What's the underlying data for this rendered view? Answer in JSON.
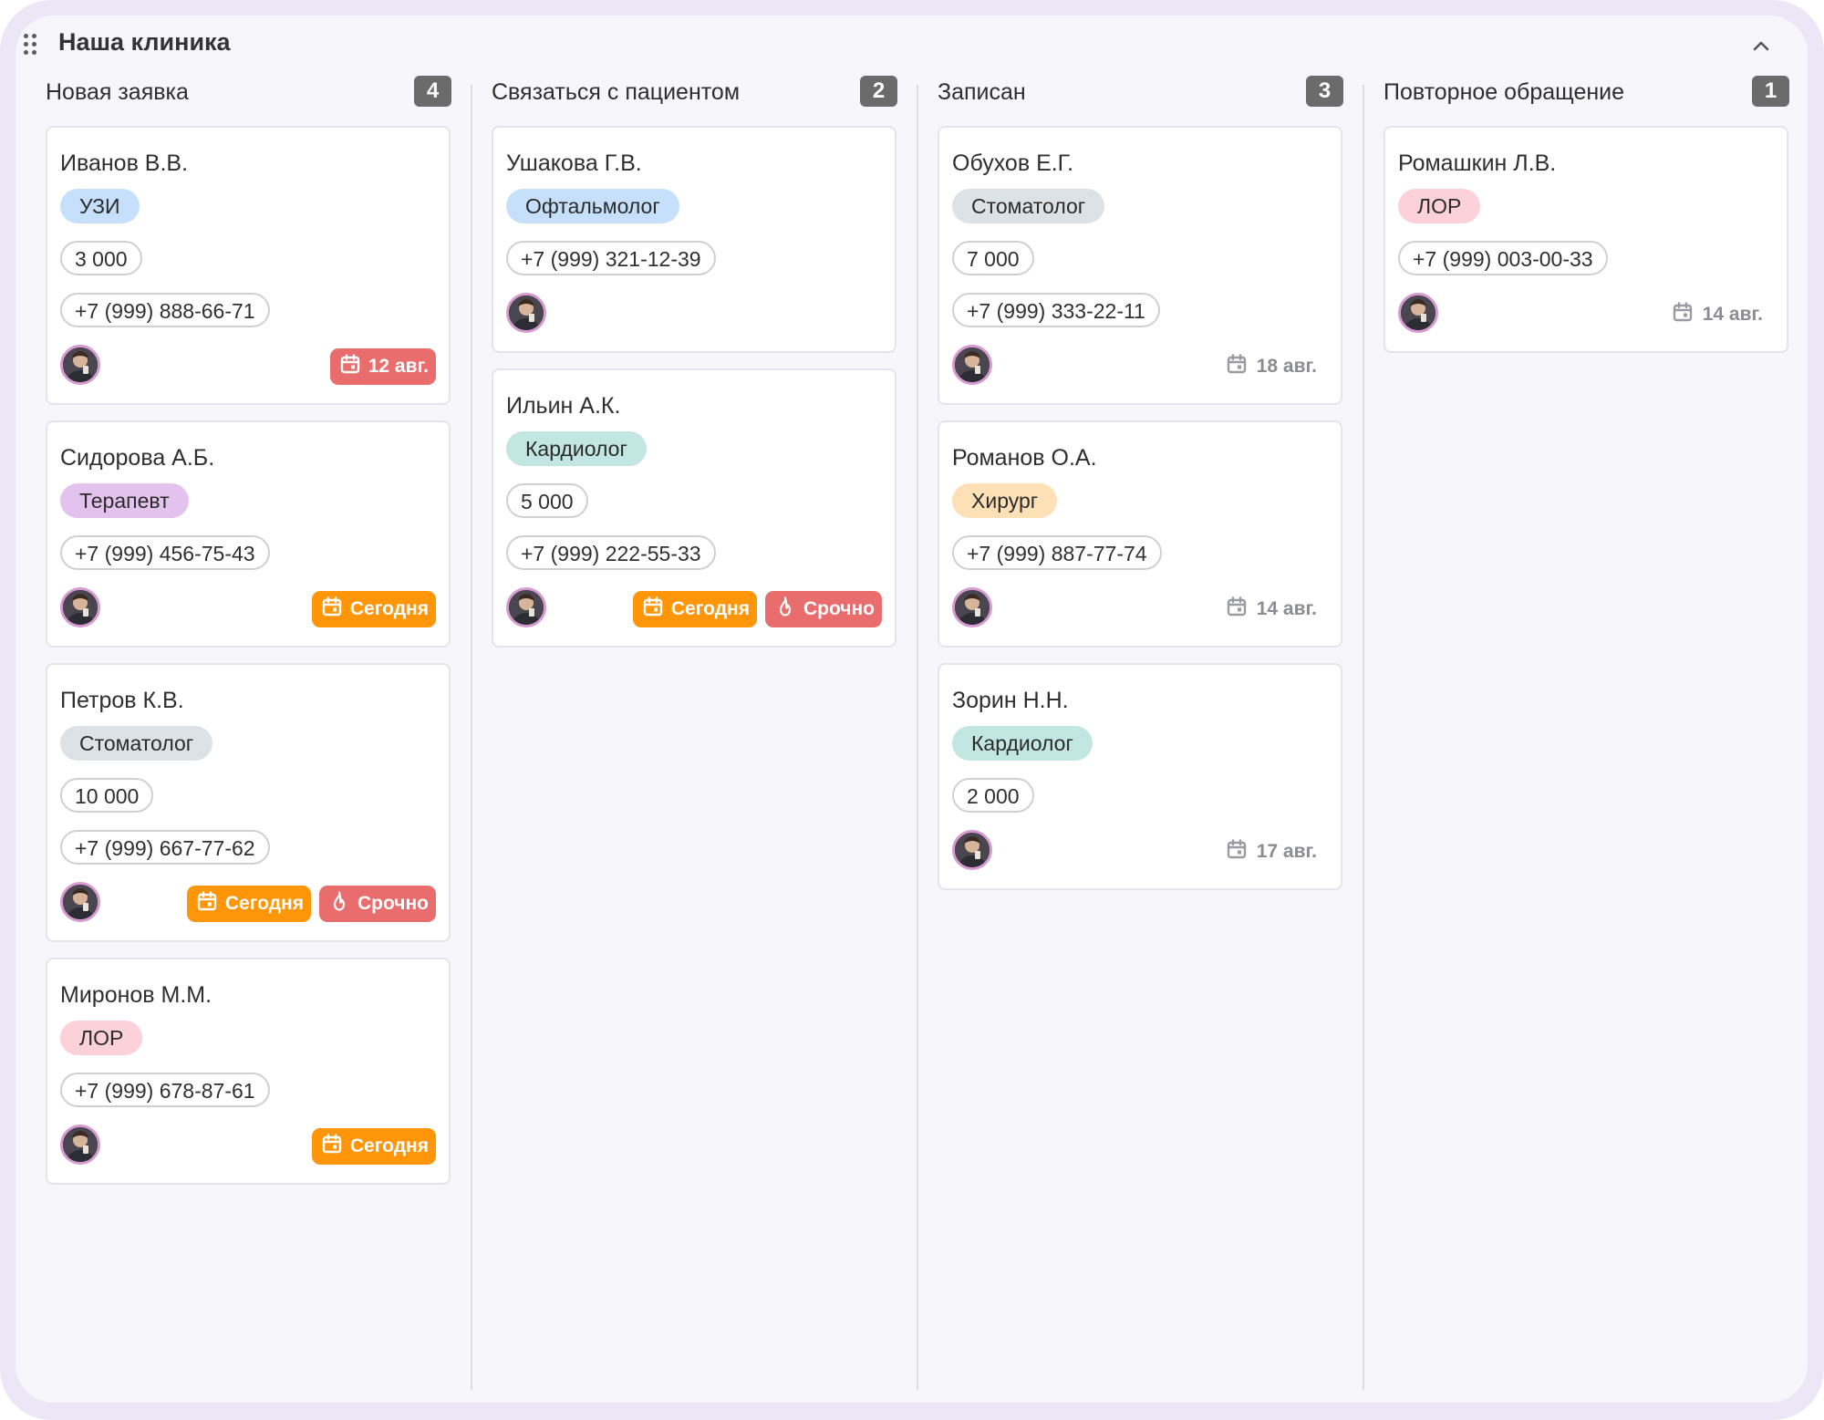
{
  "board": {
    "title": "Наша клиника"
  },
  "colors": {
    "tag_blue": "#c6e0fb",
    "tag_purple": "#e3c2ee",
    "tag_gray": "#dde2e6",
    "tag_pink": "#fcd1d9",
    "tag_teal": "#c2e6e1",
    "tag_peach": "#fde0b6",
    "badge_red": "#ea6d6d",
    "badge_orange": "#ff960a"
  },
  "columns": [
    {
      "title": "Новая заявка",
      "count": "4",
      "cards": [
        {
          "name": "Иванов В.В.",
          "tag": "УЗИ",
          "tag_color": "blue",
          "pills": [
            "3 000",
            "+7 (999) 888-66-71"
          ],
          "badges": [
            {
              "text": "12 авг.",
              "kind": "red",
              "icon": "calendar-icon"
            }
          ]
        },
        {
          "name": "Сидорова А.Б.",
          "tag": "Терапевт",
          "tag_color": "purple",
          "pills": [
            "+7 (999) 456-75-43"
          ],
          "badges": [
            {
              "text": "Сегодня",
              "kind": "orange",
              "icon": "calendar-icon"
            }
          ]
        },
        {
          "name": "Петров К.В.",
          "tag": "Стоматолог",
          "tag_color": "gray",
          "pills": [
            "10 000",
            "+7 (999) 667-77-62"
          ],
          "badges": [
            {
              "text": "Сегодня",
              "kind": "orange",
              "icon": "calendar-icon"
            },
            {
              "text": "Срочно",
              "kind": "red",
              "icon": "fire-icon"
            }
          ]
        },
        {
          "name": "Миронов М.М.",
          "tag": "ЛОР",
          "tag_color": "pink",
          "pills": [
            "+7 (999) 678-87-61"
          ],
          "badges": [
            {
              "text": "Сегодня",
              "kind": "orange",
              "icon": "calendar-icon"
            }
          ]
        }
      ]
    },
    {
      "title": "Связаться с пациентом",
      "count": "2",
      "cards": [
        {
          "name": "Ушакова Г.В.",
          "tag": "Офтальмолог",
          "tag_color": "blue",
          "pills": [
            "+7 (999) 321-12-39"
          ],
          "badges": []
        },
        {
          "name": "Ильин А.К.",
          "tag": "Кардиолог",
          "tag_color": "teal",
          "pills": [
            "5 000",
            "+7 (999) 222-55-33"
          ],
          "badges": [
            {
              "text": "Сегодня",
              "kind": "orange",
              "icon": "calendar-icon"
            },
            {
              "text": "Срочно",
              "kind": "red",
              "icon": "fire-icon"
            }
          ]
        }
      ]
    },
    {
      "title": "Записан",
      "count": "3",
      "cards": [
        {
          "name": "Обухов Е.Г.",
          "tag": "Стоматолог",
          "tag_color": "gray",
          "pills": [
            "7 000",
            "+7 (999) 333-22-11"
          ],
          "badges": [
            {
              "text": "18 авг.",
              "kind": "plain",
              "icon": "calendar-icon"
            }
          ]
        },
        {
          "name": "Романов О.А.",
          "tag": "Хирург",
          "tag_color": "peach",
          "pills": [
            "+7 (999) 887-77-74"
          ],
          "badges": [
            {
              "text": "14 авг.",
              "kind": "plain",
              "icon": "calendar-icon"
            }
          ]
        },
        {
          "name": "Зорин Н.Н.",
          "tag": "Кардиолог",
          "tag_color": "teal",
          "pills": [
            "2 000"
          ],
          "badges": [
            {
              "text": "17 авг.",
              "kind": "plain",
              "icon": "calendar-icon"
            }
          ]
        }
      ]
    },
    {
      "title": "Повторное обращение",
      "count": "1",
      "cards": [
        {
          "name": "Ромашкин Л.В.",
          "tag": "ЛОР",
          "tag_color": "pink",
          "pills": [
            "+7 (999) 003-00-33"
          ],
          "badges": [
            {
              "text": "14 авг.",
              "kind": "plain",
              "icon": "calendar-icon"
            }
          ]
        }
      ]
    }
  ]
}
